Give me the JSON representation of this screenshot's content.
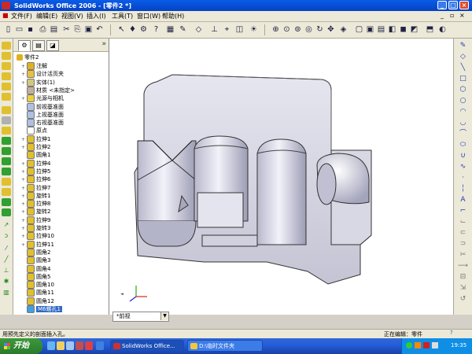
{
  "window": {
    "title": "SolidWorks Office 2006 - [零件2 *]"
  },
  "menubar": [
    "文件(F)",
    "编辑(E)",
    "视图(V)",
    "插入(I)",
    "工具(T)",
    "窗口(W)",
    "帮助(H)"
  ],
  "tree": {
    "root": "零件2",
    "items": [
      {
        "label": "注解",
        "exp": "+",
        "icon": "annotation-icon",
        "color": "#e0b020"
      },
      {
        "label": "设计活页夹",
        "exp": "+",
        "icon": "design-binder-icon",
        "color": "#e8c040"
      },
      {
        "label": "实体(1)",
        "exp": "+",
        "icon": "solid-body-icon",
        "color": "#d0c880"
      },
      {
        "label": "材质 <未指定>",
        "exp": "",
        "icon": "material-icon",
        "color": "#c0b0a0"
      },
      {
        "label": "光源与相机",
        "exp": "+",
        "icon": "lights-icon",
        "color": "#e8d040"
      },
      {
        "label": "前视基准面",
        "exp": "",
        "icon": "plane-icon",
        "color": "#b0c0e0"
      },
      {
        "label": "上视基准面",
        "exp": "",
        "icon": "plane-icon",
        "color": "#b0c0e0"
      },
      {
        "label": "右视基准面",
        "exp": "",
        "icon": "plane-icon",
        "color": "#b0c0e0"
      },
      {
        "label": "原点",
        "exp": "",
        "icon": "origin-icon",
        "color": "#ffffff"
      },
      {
        "label": "拉伸1",
        "exp": "+",
        "icon": "extrude-icon",
        "color": "#e0c030"
      },
      {
        "label": "拉伸2",
        "exp": "+",
        "icon": "extrude-icon",
        "color": "#e0c030"
      },
      {
        "label": "圆角1",
        "exp": "",
        "icon": "fillet-icon",
        "color": "#e0c030"
      },
      {
        "label": "拉伸4",
        "exp": "+",
        "icon": "extrude-icon",
        "color": "#e0c030"
      },
      {
        "label": "拉伸5",
        "exp": "+",
        "icon": "extrude-icon",
        "color": "#e0c030"
      },
      {
        "label": "拉伸6",
        "exp": "+",
        "icon": "extrude-icon",
        "color": "#e0c030"
      },
      {
        "label": "拉伸7",
        "exp": "+",
        "icon": "extrude-icon",
        "color": "#e0c030"
      },
      {
        "label": "旋转1",
        "exp": "+",
        "icon": "revolve-icon",
        "color": "#e0c030"
      },
      {
        "label": "拉伸8",
        "exp": "+",
        "icon": "extrude-icon",
        "color": "#e0c030"
      },
      {
        "label": "旋转2",
        "exp": "+",
        "icon": "revolve-icon",
        "color": "#e0c030"
      },
      {
        "label": "拉伸9",
        "exp": "+",
        "icon": "extrude-icon",
        "color": "#e0c030"
      },
      {
        "label": "旋转3",
        "exp": "+",
        "icon": "revolve-icon",
        "color": "#e0c030"
      },
      {
        "label": "拉伸10",
        "exp": "+",
        "icon": "extrude-icon",
        "color": "#e0c030"
      },
      {
        "label": "拉伸11",
        "exp": "+",
        "icon": "extrude-icon",
        "color": "#e0c030"
      },
      {
        "label": "圆角2",
        "exp": "",
        "icon": "fillet-icon",
        "color": "#e0c030"
      },
      {
        "label": "圆角3",
        "exp": "",
        "icon": "fillet-icon",
        "color": "#e0c030"
      },
      {
        "label": "圆角4",
        "exp": "",
        "icon": "fillet-icon",
        "color": "#e0c030"
      },
      {
        "label": "圆角5",
        "exp": "",
        "icon": "fillet-icon",
        "color": "#e0c030"
      },
      {
        "label": "圆角10",
        "exp": "",
        "icon": "fillet-icon",
        "color": "#e0c030"
      },
      {
        "label": "圆角11",
        "exp": "",
        "icon": "fillet-icon",
        "color": "#e0c030"
      },
      {
        "label": "圆角12",
        "exp": "",
        "icon": "fillet-icon",
        "color": "#e0c030"
      },
      {
        "label": "M6螺孔1",
        "exp": "",
        "icon": "hole-wizard-icon",
        "color": "#40a0e0",
        "selected": true
      }
    ]
  },
  "viewport": {
    "view_select": "*前视"
  },
  "statusbar": {
    "left": "用预先定义的剖面插入孔。",
    "mid": "正在编辑：零件"
  },
  "taskbar": {
    "start": "开始",
    "tasks": [
      "SolidWorks Office...",
      "D:\\临时文件夹"
    ],
    "clock": "19:35"
  },
  "colors": {
    "accent": "#0a5ce8",
    "selection": "#316ac5",
    "part": "#c8c8d8"
  }
}
